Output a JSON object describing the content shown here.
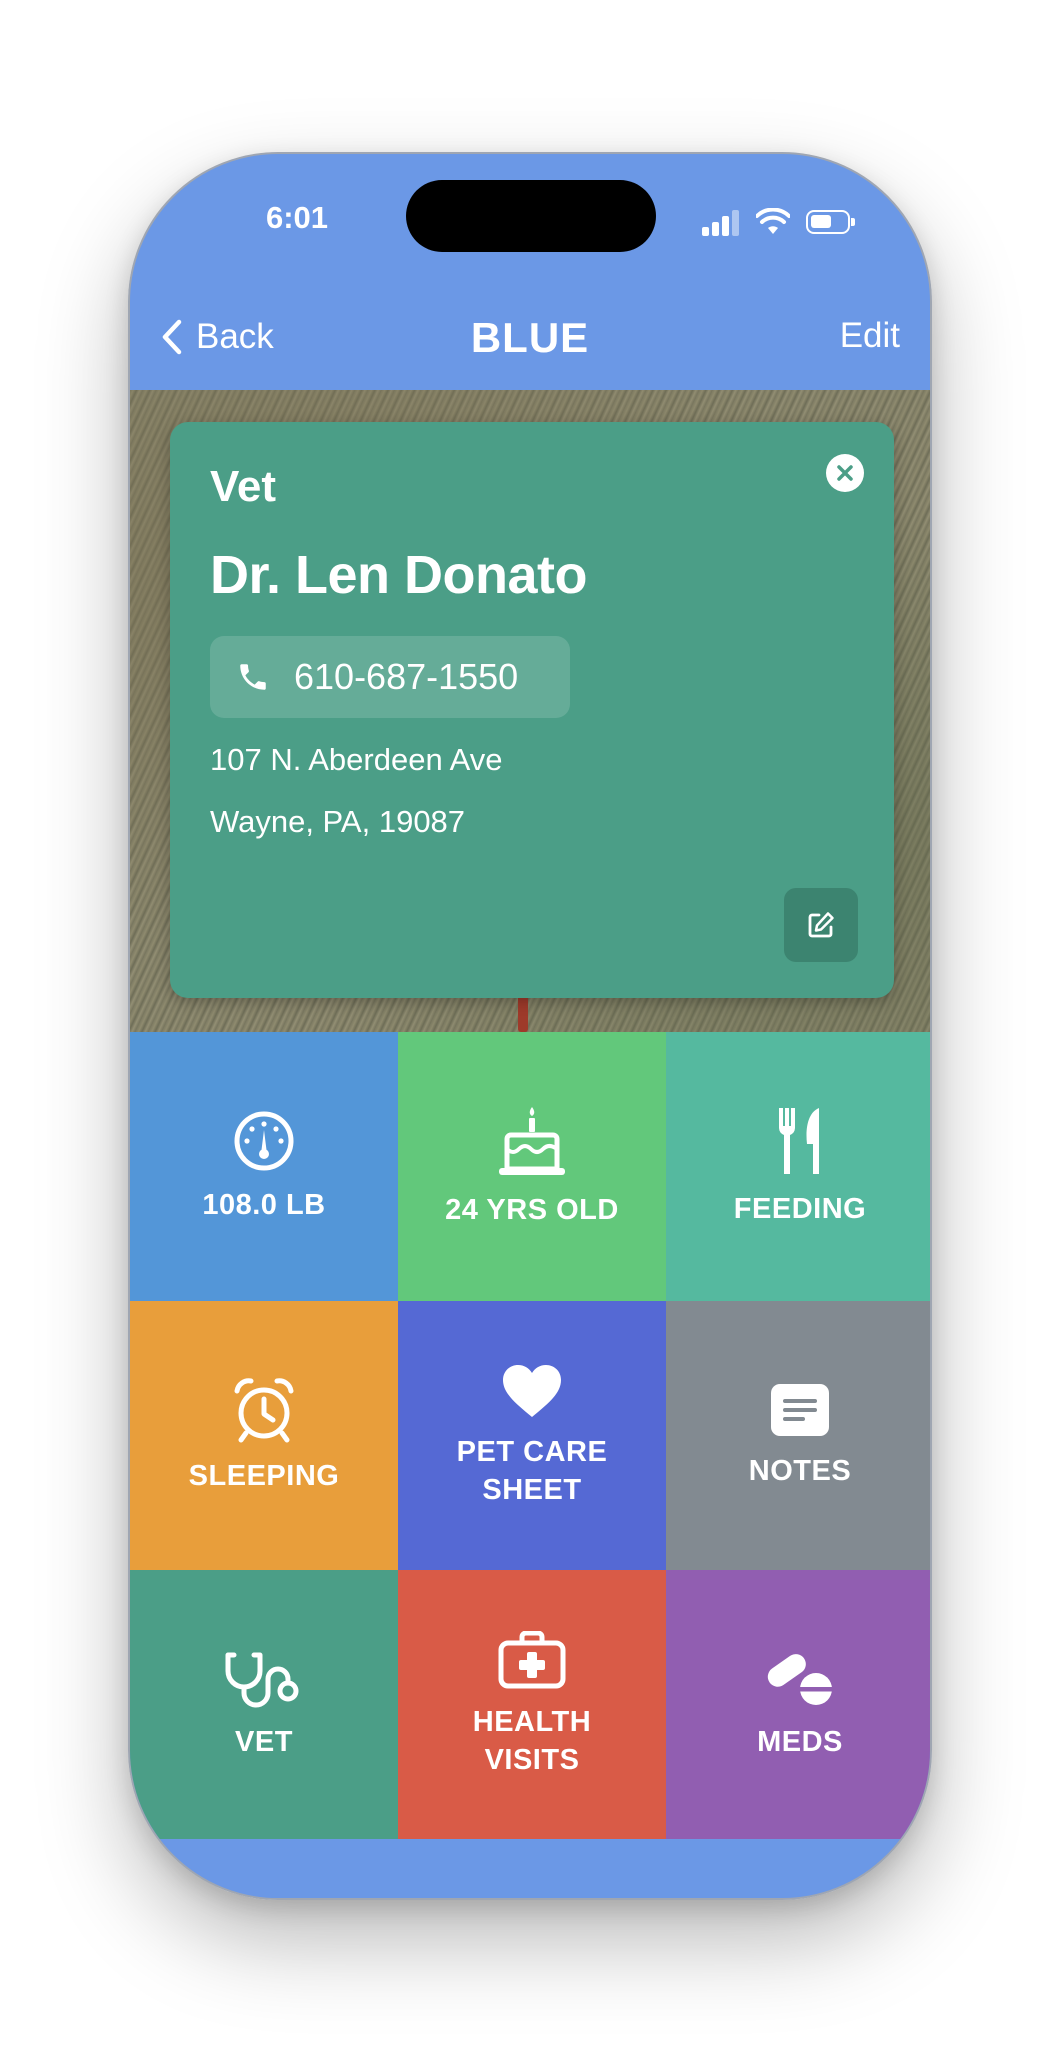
{
  "status": {
    "time": "6:01"
  },
  "nav": {
    "back_label": "Back",
    "title": "BLUE",
    "edit_label": "Edit"
  },
  "vet_card": {
    "label": "Vet",
    "name": "Dr. Len Donato",
    "phone": "610-687-1550",
    "address_line1": "107 N. Aberdeen Ave",
    "address_line2": "Wayne, PA, 19087"
  },
  "tiles": [
    {
      "label": "108.0 LB",
      "icon": "gauge-icon",
      "color": "#5396d8"
    },
    {
      "label": "24 YRS OLD",
      "icon": "cake-icon",
      "color": "#62c87b"
    },
    {
      "label": "FEEDING",
      "icon": "fork-knife-icon",
      "color": "#55b99f"
    },
    {
      "label": "SLEEPING",
      "icon": "alarm-clock-icon",
      "color": "#e89e3b"
    },
    {
      "label_line1": "PET CARE",
      "label_line2": "SHEET",
      "icon": "heart-icon",
      "color": "#5569d4"
    },
    {
      "label": "NOTES",
      "icon": "notes-icon",
      "color": "#828a91"
    },
    {
      "label": "VET",
      "icon": "stethoscope-icon",
      "color": "#4b9e87"
    },
    {
      "label_line1": "HEALTH",
      "label_line2": "VISITS",
      "icon": "medical-kit-icon",
      "color": "#d95b47"
    },
    {
      "label": "MEDS",
      "icon": "pills-icon",
      "color": "#915eb1"
    }
  ],
  "colors": {
    "nav_background": "#6b98e6",
    "card_background": "#4b9e87"
  }
}
